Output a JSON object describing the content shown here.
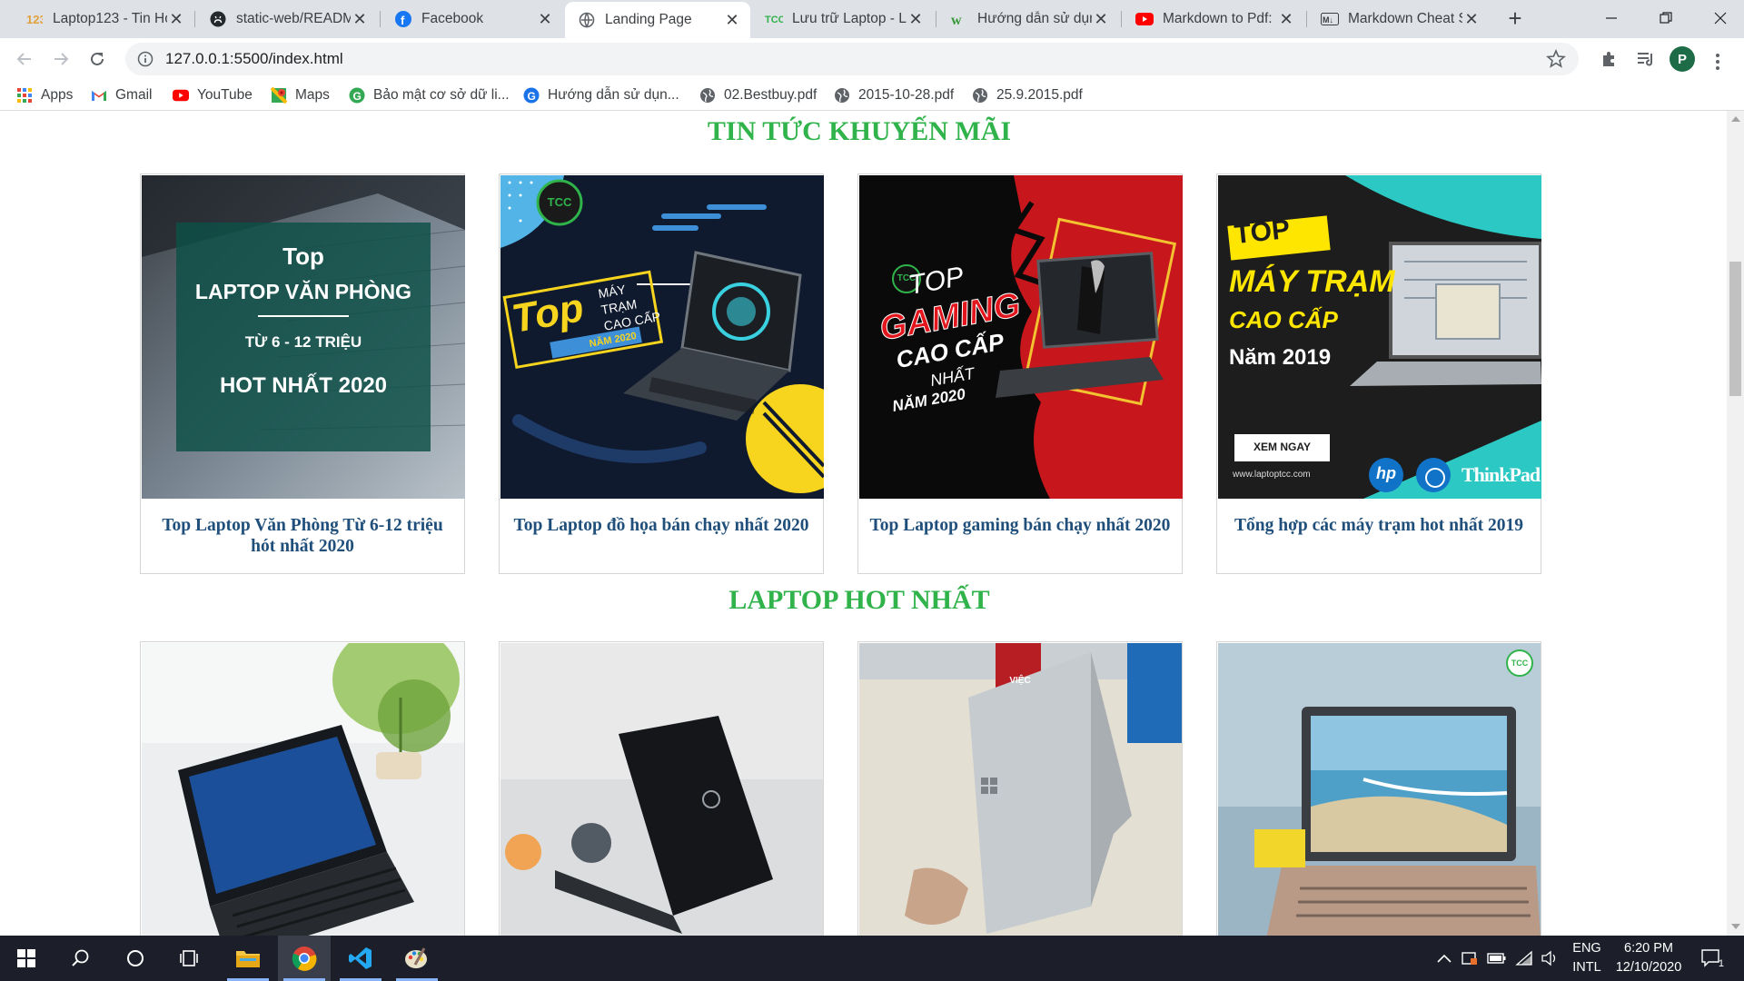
{
  "browser": {
    "tabs": [
      {
        "title": "Laptop123 - Tin Học",
        "icon": "laptop123-favicon",
        "active": false
      },
      {
        "title": "static-web/README",
        "icon": "github-icon",
        "active": false
      },
      {
        "title": "Facebook",
        "icon": "facebook-icon",
        "active": false
      },
      {
        "title": "Landing Page",
        "icon": "globe-icon",
        "active": true
      },
      {
        "title": "Lưu trữ Laptop - La",
        "icon": "tcc-favicon",
        "active": false
      },
      {
        "title": "Hướng dẫn sử dụn",
        "icon": "leaf-favicon",
        "active": false
      },
      {
        "title": "Markdown to Pdf:",
        "icon": "youtube-icon",
        "active": false
      },
      {
        "title": "Markdown Cheat S",
        "icon": "markdown-icon",
        "active": false
      }
    ],
    "url": "127.0.0.1:5500/index.html",
    "profile_initial": "P",
    "bookmarks": [
      {
        "label": "Apps",
        "icon": "apps-grid-icon"
      },
      {
        "label": "Gmail",
        "icon": "gmail-icon"
      },
      {
        "label": "YouTube",
        "icon": "youtube-icon"
      },
      {
        "label": "Maps",
        "icon": "maps-icon"
      },
      {
        "label": "Bảo mật cơ sở dữ li...",
        "icon": "green-g-icon"
      },
      {
        "label": "Hướng dẫn sử dụn...",
        "icon": "blue-g-icon"
      },
      {
        "label": "02.Bestbuy.pdf",
        "icon": "globe-icon"
      },
      {
        "label": "2015-10-28.pdf",
        "icon": "globe-icon"
      },
      {
        "label": "25.9.2015.pdf",
        "icon": "globe-icon"
      }
    ]
  },
  "page": {
    "promo_title": "TIN TỨC KHUYẾN MÃI",
    "promo_cards": [
      {
        "caption": "Top Laptop Văn Phòng Từ 6-12 triệu hót nhất 2020",
        "banner": {
          "line1": "Top",
          "line2": "LAPTOP VĂN PHÒNG",
          "line3": "TỪ 6 - 12 TRIỆU",
          "line4": "HOT NHẤT 2020"
        }
      },
      {
        "caption": "Top Laptop đồ họa bán chạy nhất 2020",
        "banner": {
          "top": "Top",
          "sub1": "MÁY TRẠM",
          "sub2": "CAO CẤP",
          "year": "NĂM 2020",
          "logo": "TCC"
        }
      },
      {
        "caption": "Top Laptop gaming bán chạy nhất 2020",
        "banner": {
          "top": "TOP",
          "line2": "GAMING",
          "line3": "CAO CẤP",
          "line4": "NHẤT",
          "line5": "NĂM 2020",
          "logo": "TCC"
        }
      },
      {
        "caption": "Tổng hợp các máy trạm hot nhất 2019",
        "banner": {
          "top": "TOP",
          "line2": "MÁY TRẠM",
          "line3": "CAO CẤP",
          "line4": "Năm 2019",
          "cta": "XEM NGAY",
          "site": "www.laptoptcc.com",
          "brand1": "hp",
          "brand3": "ThinkPad"
        }
      }
    ],
    "hot_title": "LAPTOP HOT NHẤT",
    "hot_cards": [
      {
        "photo": "dell-black-laptop-with-plant"
      },
      {
        "photo": "dell-laptop-lid-closed"
      },
      {
        "photo": "microsoft-surface-laptop-silver",
        "sign_text": "VIỆC"
      },
      {
        "photo": "dell-laptop-beach-wallpaper",
        "logo": "TCC"
      }
    ]
  },
  "taskbar": {
    "apps": [
      "windows-start",
      "search",
      "cortana",
      "task-view",
      "file-explorer",
      "chrome",
      "vscode",
      "paint"
    ],
    "lang_line1": "ENG",
    "lang_line2": "INTL",
    "time": "6:20 PM",
    "date": "12/10/2020",
    "notification_count": "1"
  },
  "colors": {
    "section_title": "#2fb34a",
    "card_caption": "#1f4f7a",
    "taskbar": "#1c1f2a"
  }
}
